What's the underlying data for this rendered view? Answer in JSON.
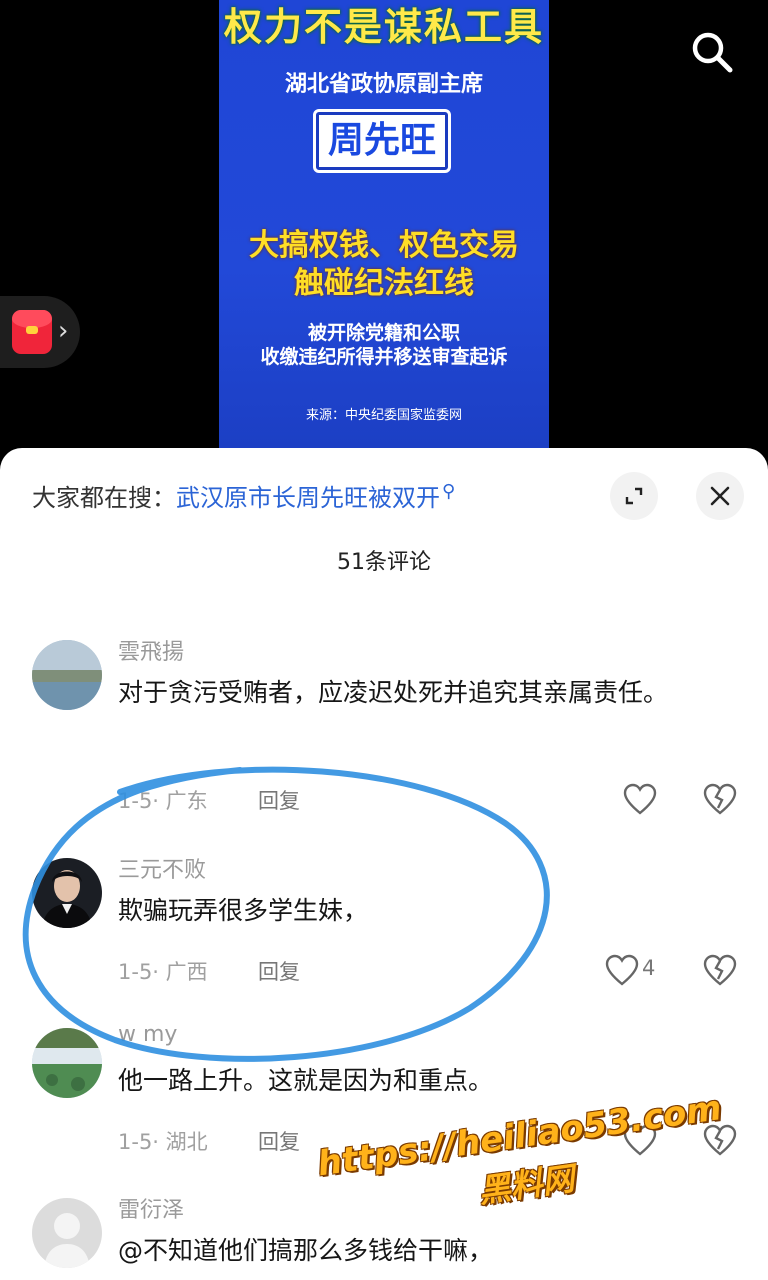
{
  "poster": {
    "headline": "权力不是谋私工具",
    "subtitle": "湖北省政协原副主席",
    "name": "周先旺",
    "charge_line1": "大搞权钱、权色交易",
    "charge_line2": "触碰纪法红线",
    "action_line1": "被开除党籍和公职",
    "action_line2": "收缴违纪所得并移送审查起诉",
    "source": "来源：中央纪委国家监委网"
  },
  "sheet": {
    "search_prefix": "大家都在搜：",
    "search_link": "武汉原市长周先旺被双开",
    "comment_count": "51条评论"
  },
  "comments": [
    {
      "user": "雲飛揚",
      "text": "对于贪污受贿者，应凌迟处死并追究其亲属责任。",
      "meta": "1-5· 广东",
      "reply": "回复",
      "likes": ""
    },
    {
      "user": "三元不败",
      "text": "欺骗玩弄很多学生妹，",
      "meta": "1-5· 广西",
      "reply": "回复",
      "likes": "4"
    },
    {
      "user": "w my",
      "text": "他一路上升。这就是因为和重点。",
      "meta": "1-5· 湖北",
      "reply": "回复",
      "likes": ""
    },
    {
      "user": "雷衍泽",
      "text": "@不知道他们搞那么多钱给干嘛，",
      "meta": "",
      "reply": "",
      "likes": ""
    }
  ],
  "icons": {
    "search": "search-icon",
    "red_packet": "red-packet-icon",
    "expand": "expand-icon",
    "close": "close-icon",
    "like": "heart-icon",
    "dislike": "broken-heart-icon"
  },
  "colors": {
    "poster_blue": "#2249d8",
    "headline_yellow": "#ffe94a",
    "link_blue": "#2b64d6",
    "annotation_blue": "#2f8fe0",
    "watermark_orange": "#ffb21a"
  },
  "watermark": {
    "url": "https://heiliao53.com",
    "name": "黑料网"
  }
}
